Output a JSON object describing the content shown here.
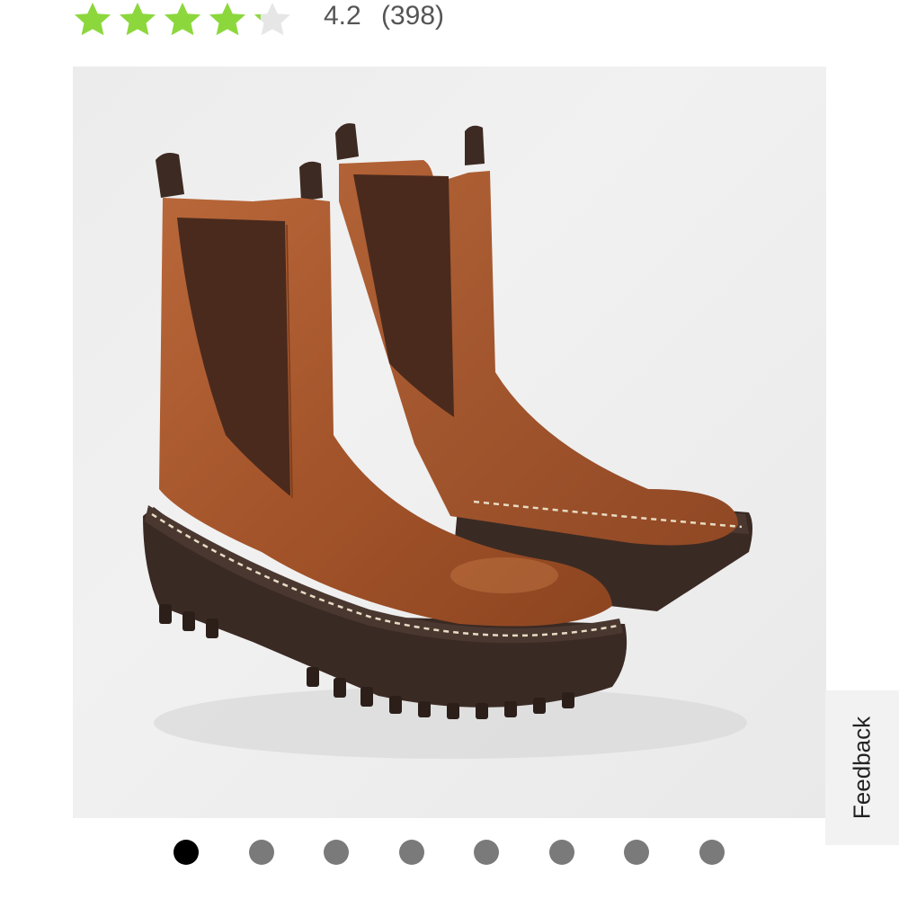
{
  "rating": {
    "stars_value": 4.2,
    "stars_max": 5,
    "value_text": "4.2",
    "count_text": "(398)",
    "star_color": "#8cd83c",
    "star_empty_color": "#e6e6e6"
  },
  "product_image": {
    "subject": "brown-leather-chelsea-boots",
    "colors": {
      "leather": "#a9592b",
      "elastic": "#4a2a1d",
      "sole": "#3a2a24",
      "stitch": "#e8dcc4"
    }
  },
  "carousel": {
    "count": 8,
    "active_index": 0,
    "active_color": "#000000",
    "inactive_color": "#7a7a7a"
  },
  "feedback": {
    "label": "Feedback"
  }
}
